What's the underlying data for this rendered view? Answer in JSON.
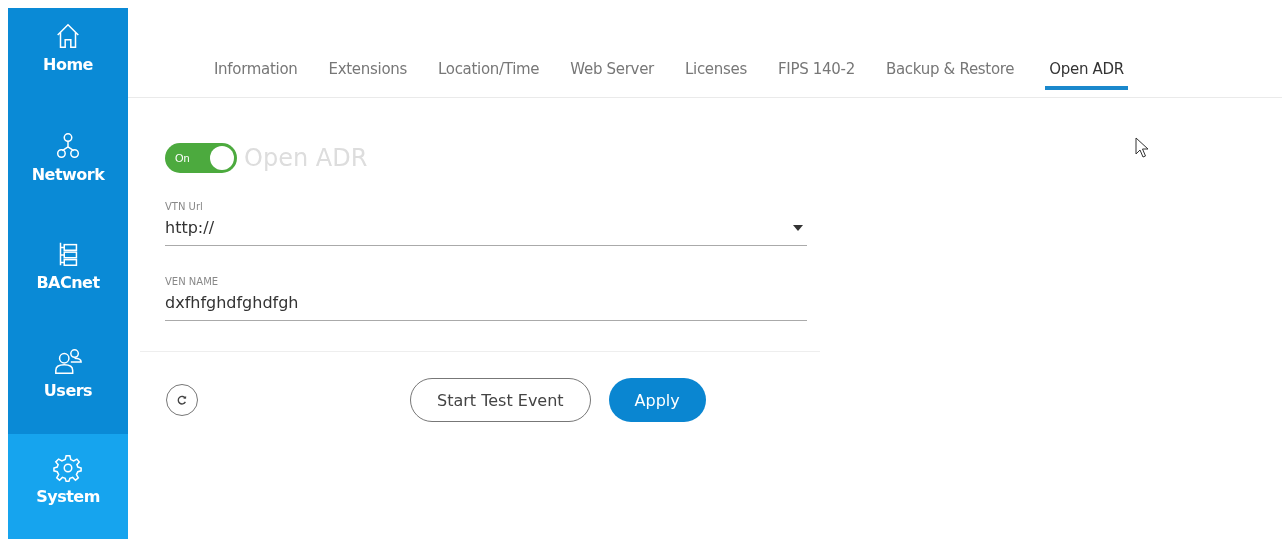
{
  "sidebar": {
    "items": [
      {
        "label": "Home",
        "selected": false
      },
      {
        "label": "Network",
        "selected": false
      },
      {
        "label": "BACnet",
        "selected": false
      },
      {
        "label": "Users",
        "selected": false
      },
      {
        "label": "System",
        "selected": true
      }
    ]
  },
  "tabs": [
    {
      "label": "Information",
      "selected": false
    },
    {
      "label": "Extensions",
      "selected": false
    },
    {
      "label": "Location/Time",
      "selected": false
    },
    {
      "label": "Web Server",
      "selected": false
    },
    {
      "label": "Licenses",
      "selected": false
    },
    {
      "label": "FIPS 140-2",
      "selected": false
    },
    {
      "label": "Backup & Restore",
      "selected": false
    },
    {
      "label": "Open ADR",
      "selected": true
    }
  ],
  "toggle": {
    "label": "On",
    "on": true,
    "title": "Open ADR"
  },
  "fields": [
    {
      "kind": "dropdown",
      "label": "VTN Url",
      "value": "http://"
    },
    {
      "kind": "text",
      "label": "VEN NAME",
      "value": "dxfhfghdfghdfgh"
    }
  ],
  "buttons": [
    {
      "label": "Start Test Event",
      "kind": "outline"
    },
    {
      "label": "Apply",
      "kind": "primary"
    }
  ]
}
